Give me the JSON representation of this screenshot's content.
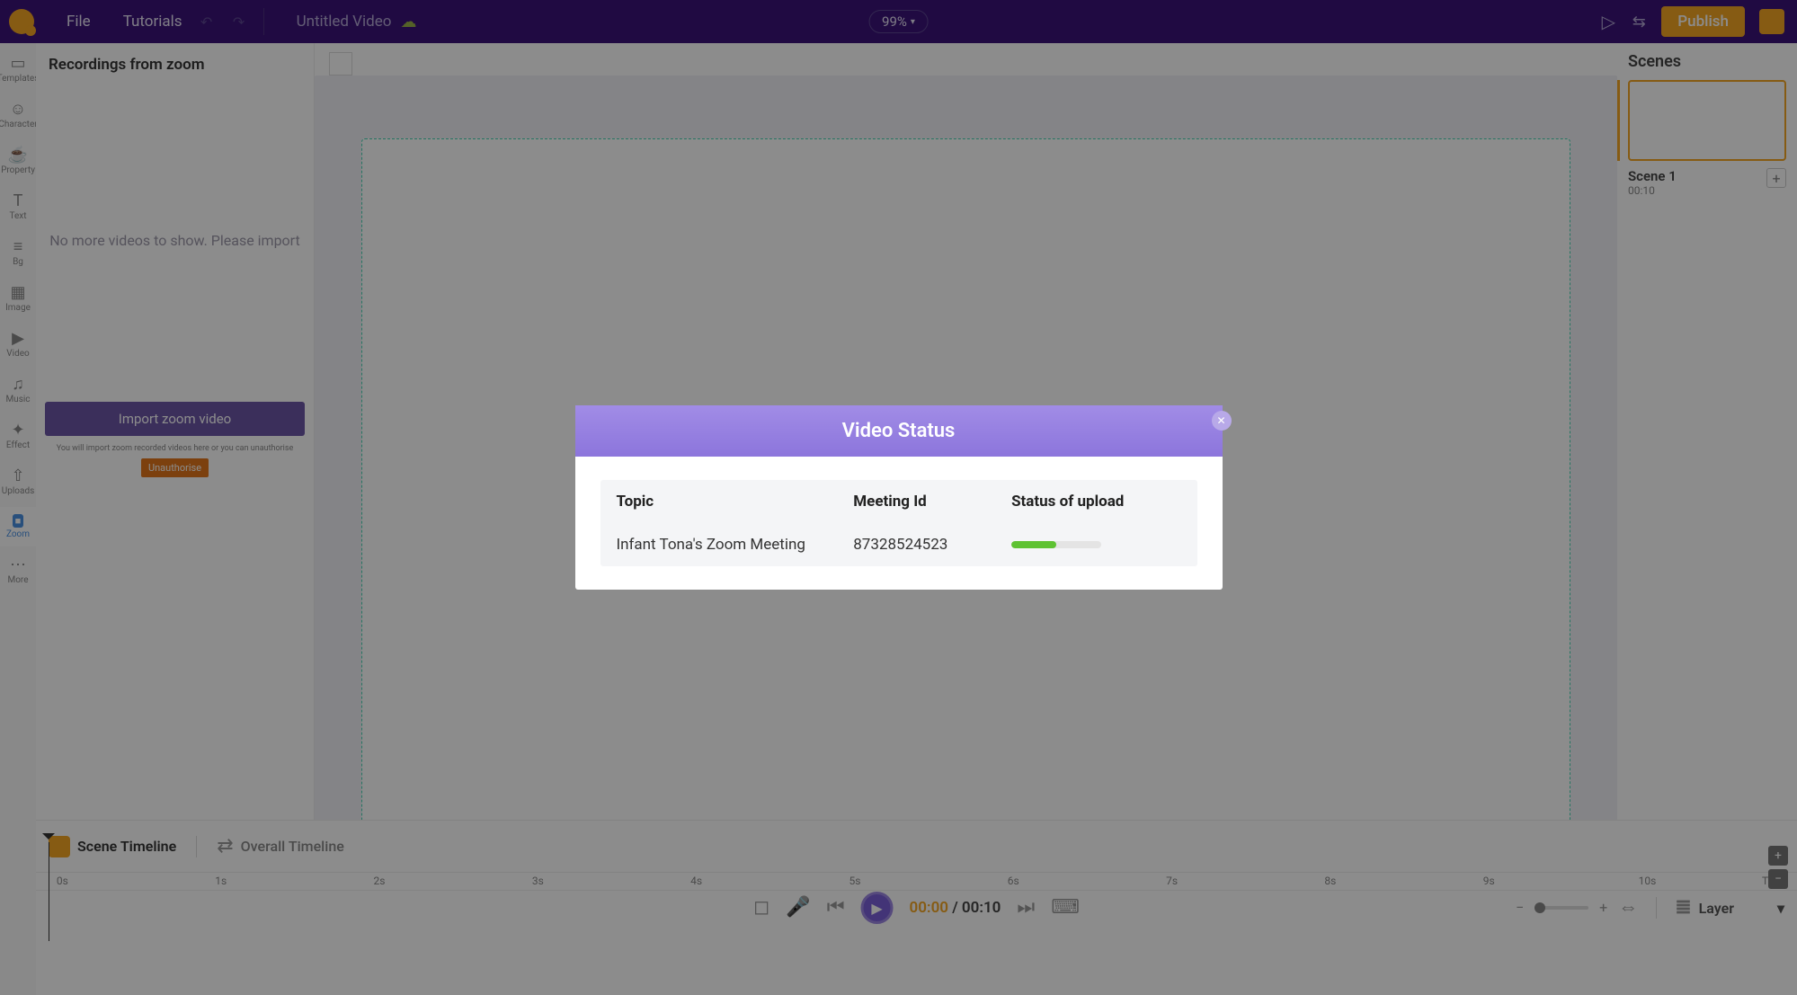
{
  "header": {
    "file_label": "File",
    "tutorials_label": "Tutorials",
    "title": "Untitled Video",
    "zoom_level": "99%",
    "publish_label": "Publish"
  },
  "sidebar": {
    "items": [
      {
        "label": "Templates"
      },
      {
        "label": "Character"
      },
      {
        "label": "Property"
      },
      {
        "label": "Text"
      },
      {
        "label": "Bg"
      },
      {
        "label": "Image"
      },
      {
        "label": "Video"
      },
      {
        "label": "Music"
      },
      {
        "label": "Effect"
      },
      {
        "label": "Uploads"
      },
      {
        "label": "Zoom"
      },
      {
        "label": "More"
      }
    ]
  },
  "panel": {
    "title": "Recordings from zoom",
    "empty_text": "No more videos to show. Please import",
    "import_label": "Import zoom video",
    "auth_text": "You will import zoom recorded videos here or you can unauthorise",
    "unauth_label": "Unauthorise"
  },
  "scenes": {
    "title": "Scenes",
    "scene_label": "Scene 1",
    "scene_time": "00:10"
  },
  "timeline": {
    "scene_tl_label": "Scene Timeline",
    "overall_tl_label": "Overall Timeline",
    "current_time": "00:00",
    "separator": " / ",
    "duration": "00:10",
    "layer_label": "Layer",
    "ticks": [
      "0s",
      "1s",
      "2s",
      "3s",
      "4s",
      "5s",
      "6s",
      "7s",
      "8s",
      "9s",
      "10s"
    ],
    "time_col_label": "Time"
  },
  "modal": {
    "title": "Video Status",
    "headers": {
      "topic": "Topic",
      "mid": "Meeting Id",
      "status": "Status of upload"
    },
    "row": {
      "topic": "Infant Tona's Zoom Meeting",
      "mid": "87328524523",
      "progress_pct": 50
    }
  }
}
